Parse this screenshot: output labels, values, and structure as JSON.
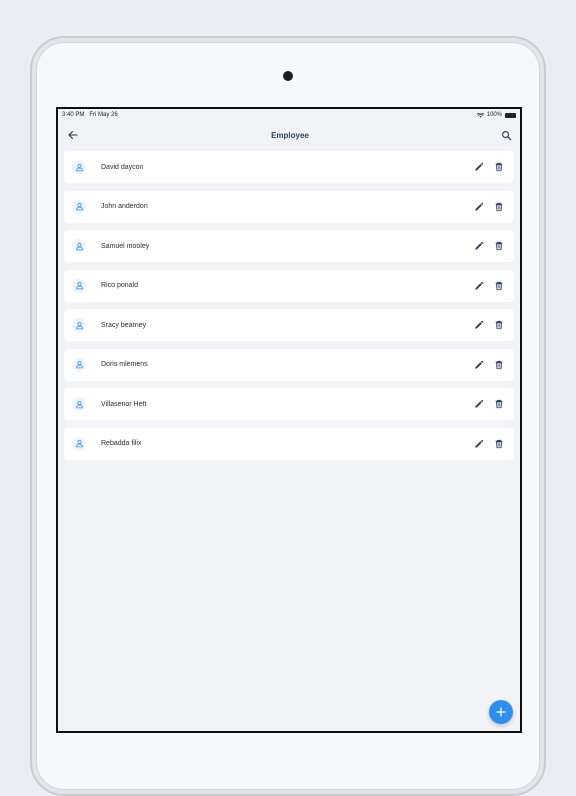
{
  "status": {
    "time": "3:40 PM",
    "date": "Fri May 26",
    "battery": "100%"
  },
  "header": {
    "title": "Employee",
    "back_icon": "arrow-left-icon",
    "search_icon": "search-icon"
  },
  "employees": [
    {
      "name": "David daycon"
    },
    {
      "name": "John anderdon"
    },
    {
      "name": "Samuel mooley"
    },
    {
      "name": "Rico ponald"
    },
    {
      "name": "Sracy bearney"
    },
    {
      "name": "Doris mlemens"
    },
    {
      "name": "Villasenor Hett"
    },
    {
      "name": "Rebadda filix"
    }
  ],
  "icons": {
    "avatar": "person-icon",
    "edit": "pencil-icon",
    "delete": "trash-icon",
    "add": "plus-icon"
  },
  "colors": {
    "accent": "#2f8dee",
    "title": "#2f3f59",
    "background": "#f2f3f7"
  }
}
